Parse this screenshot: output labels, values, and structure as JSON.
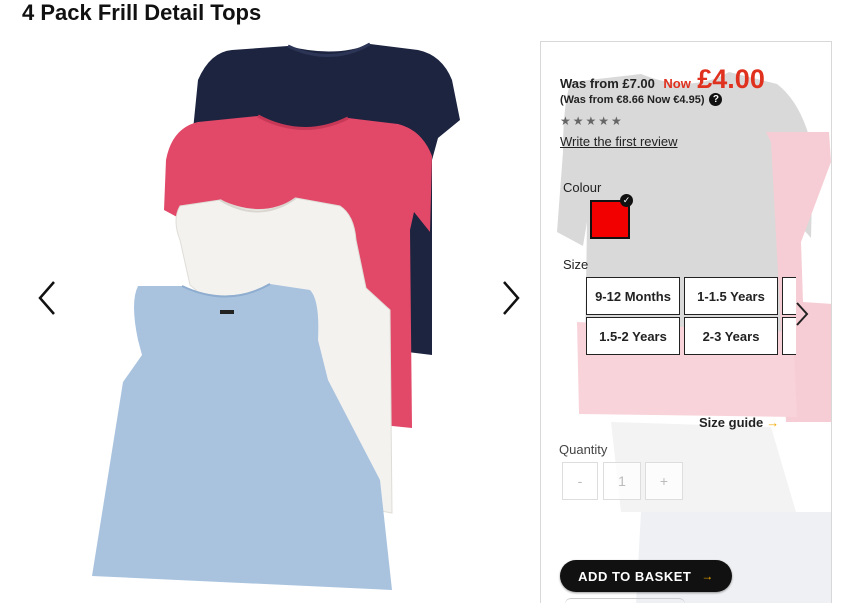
{
  "page": {
    "title": "4 Pack Frill Detail Tops"
  },
  "gallery": {
    "prev_icon": "chevron-left-icon",
    "next_icon": "chevron-right-icon",
    "tops": [
      {
        "colour": "navy",
        "hex": "#1c2440"
      },
      {
        "colour": "pink",
        "hex": "#e24868"
      },
      {
        "colour": "white",
        "hex": "#f3f2ef"
      },
      {
        "colour": "light-blue",
        "hex": "#a9c3df"
      }
    ]
  },
  "price": {
    "was": "Was from £7.00",
    "now_label": "Now",
    "now_price": "£4.00",
    "euro": "(Was from €8.66 Now €4.95)",
    "help_icon": "?",
    "stars": "★★★★★",
    "review_link": "Write the first review"
  },
  "colour": {
    "label": "Colour",
    "selected": "#f20000",
    "check_icon": "✓"
  },
  "size": {
    "label": "Size",
    "options": [
      "9-12 Months",
      "1-1.5 Years",
      "1.5-2 Years",
      "2-3 Years"
    ],
    "more_icon": "chevron-right-icon"
  },
  "size_guide": {
    "label": "Size guide",
    "chev": "→"
  },
  "quantity": {
    "label": "Quantity",
    "minus": "-",
    "value": "1",
    "plus": "+"
  },
  "basket": {
    "label": "ADD TO BASKET",
    "chev": "→"
  },
  "colors": {
    "accent": "#e0301e",
    "arrow": "#f5a800"
  }
}
